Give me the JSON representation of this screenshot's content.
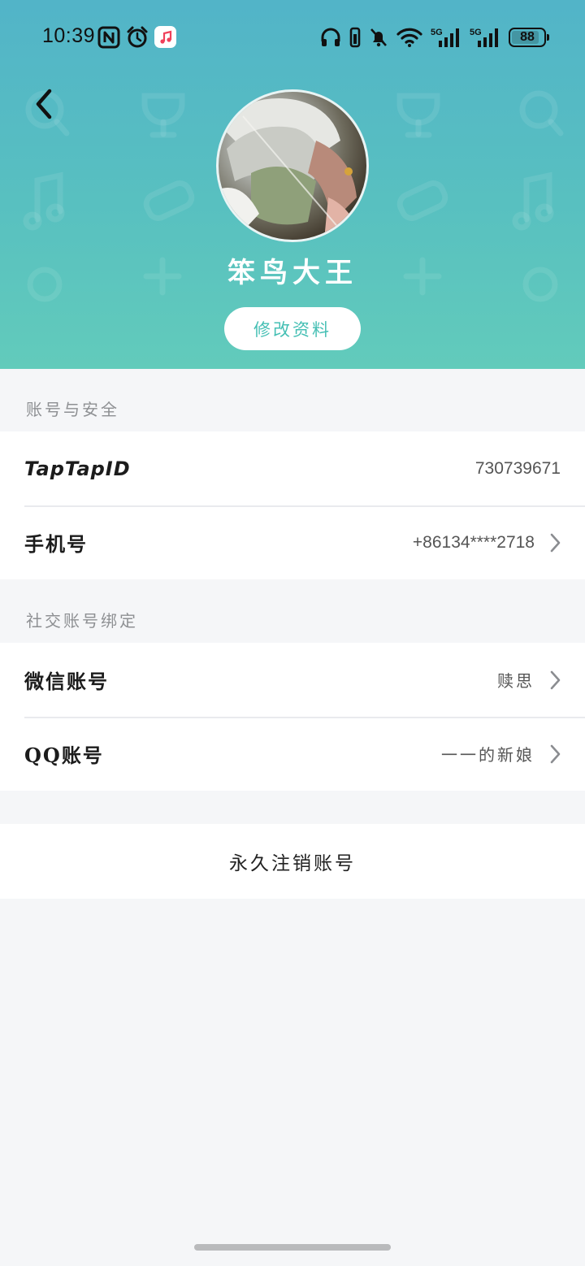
{
  "status_bar": {
    "time": "10:39",
    "battery_level": "88",
    "battery_fraction": 0.88,
    "left_icons": [
      "nfc-icon",
      "alarm-icon",
      "music-app-icon"
    ],
    "right_icons": [
      "headphones-icon",
      "vibrate-icon",
      "mute-bell-icon",
      "wifi-icon",
      "5g-signal-icon",
      "5g-signal-icon",
      "battery-icon"
    ]
  },
  "header": {
    "back_icon": "chevron-left-icon",
    "username": "笨鸟大王",
    "edit_profile_label": "修改资料",
    "colors": {
      "gradient_top": "#52b4c8",
      "gradient_bottom": "#62cbbb",
      "accent_text": "#45bfb4"
    }
  },
  "account_security": {
    "section_title": "账号与安全",
    "rows": [
      {
        "label": "TapTapID",
        "value": "730739671"
      },
      {
        "label": "手机号",
        "value": "+86134****2718"
      }
    ]
  },
  "social_binding": {
    "section_title": "社交账号绑定",
    "rows": [
      {
        "label": "微信账号",
        "value": "赎思"
      },
      {
        "label": "QQ账号",
        "value": "一一的新娘"
      }
    ]
  },
  "delete_account_label": "永久注销账号"
}
